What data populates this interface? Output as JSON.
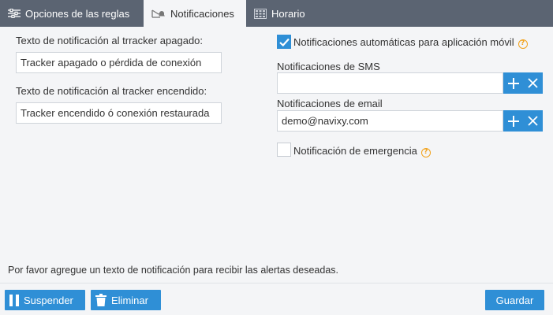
{
  "tabs": [
    {
      "label": "Opciones de las reglas",
      "icon": "sliders-icon"
    },
    {
      "label": "Notificaciones",
      "icon": "mail-bell-icon"
    },
    {
      "label": "Horario",
      "icon": "calendar-grid-icon"
    }
  ],
  "left": {
    "off_label": "Texto de notificación al trracker apagado:",
    "off_value": "Tracker apagado o pérdida de conexión",
    "on_label": "Texto de notificación al tracker encendido:",
    "on_value": "Tracker encendido ó conexión restaurada"
  },
  "right": {
    "auto_notif_label": "Notificaciones automáticas para aplicación móvil",
    "auto_notif_checked": true,
    "sms_label": "Notificaciones de SMS",
    "sms_value": "",
    "email_label": "Notificaciones de email",
    "email_value": "demo@navixy.com",
    "emergency_label": "Notificación de emergencia",
    "emergency_checked": false,
    "help_glyph": "?"
  },
  "hint": "Por favor agregue un texto de notificación para recibir las alertas deseadas.",
  "footer": {
    "suspend_label": "Suspender",
    "delete_label": "Eliminar",
    "save_label": "Guardar"
  },
  "colors": {
    "accent": "#2f8fd6",
    "tabbar": "#5b6472",
    "help": "#f2a21b"
  }
}
